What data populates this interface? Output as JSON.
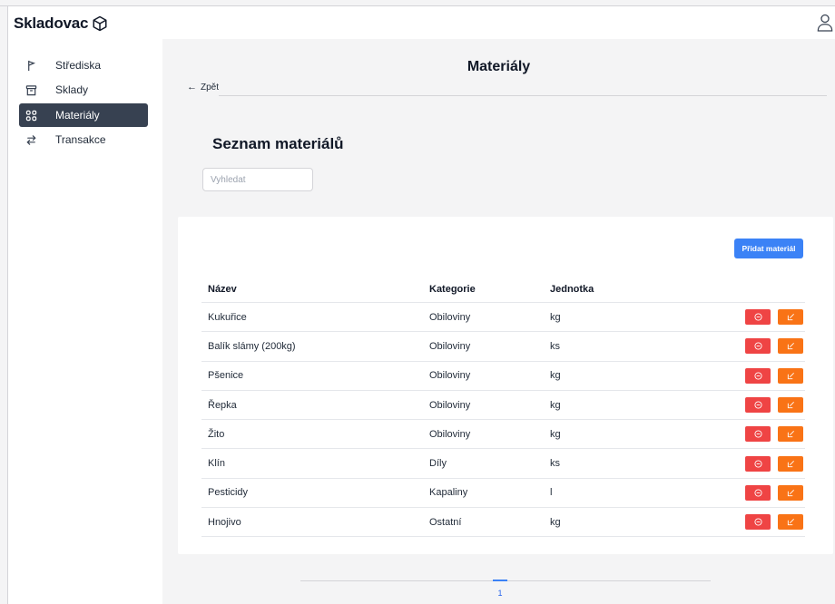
{
  "app": {
    "brand": "Skladovac"
  },
  "sidebar": {
    "items": [
      {
        "label": "Střediska",
        "icon": "flag-icon",
        "active": false
      },
      {
        "label": "Sklady",
        "icon": "archive-icon",
        "active": false
      },
      {
        "label": "Materiály",
        "icon": "grid-icon",
        "active": true
      },
      {
        "label": "Transakce",
        "icon": "arrows-exchange-icon",
        "active": false
      }
    ]
  },
  "header": {
    "title": "Materiály",
    "back_label": "Zpět"
  },
  "section": {
    "title": "Seznam materiálů",
    "search_placeholder": "Vyhledat",
    "add_button": "Přidat materiál"
  },
  "table": {
    "columns": [
      "Název",
      "Kategorie",
      "Jednotka"
    ],
    "rows": [
      {
        "name": "Kukuřice",
        "category": "Obiloviny",
        "unit": "kg"
      },
      {
        "name": "Balík slámy (200kg)",
        "category": "Obiloviny",
        "unit": "ks"
      },
      {
        "name": "Pšenice",
        "category": "Obiloviny",
        "unit": "kg"
      },
      {
        "name": "Řepka",
        "category": "Obiloviny",
        "unit": "kg"
      },
      {
        "name": "Žito",
        "category": "Obiloviny",
        "unit": "kg"
      },
      {
        "name": "Klín",
        "category": "Díly",
        "unit": "ks"
      },
      {
        "name": "Pesticidy",
        "category": "Kapaliny",
        "unit": "l"
      },
      {
        "name": "Hnojivo",
        "category": "Ostatní",
        "unit": "kg"
      }
    ]
  },
  "pagination": {
    "current": "1"
  },
  "colors": {
    "primary": "#3b82f6",
    "delete": "#ef4444",
    "edit": "#f97316",
    "sidebar_active": "#374151"
  }
}
